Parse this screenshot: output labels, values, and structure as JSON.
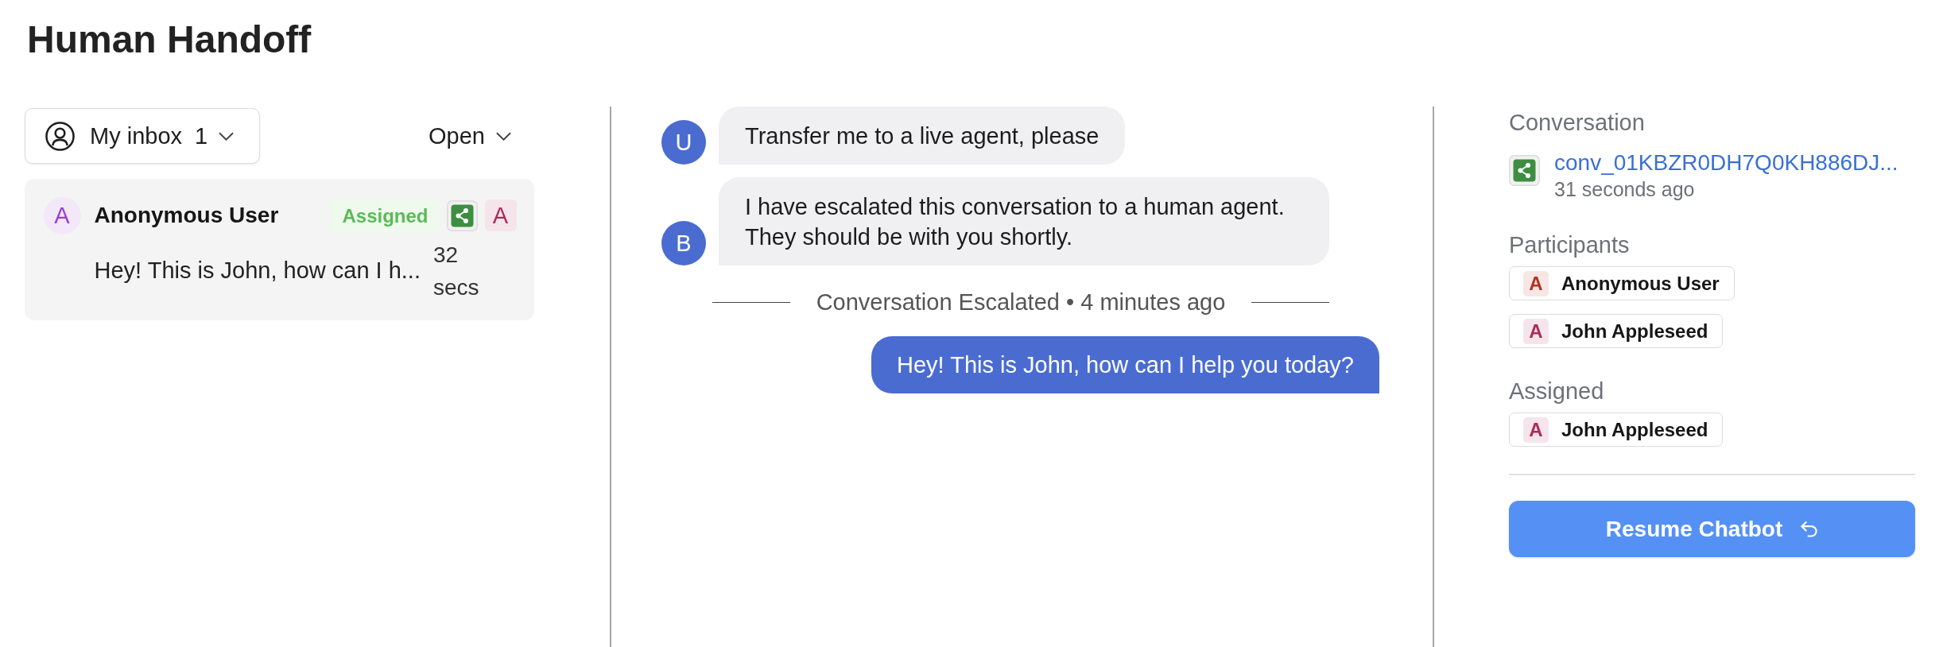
{
  "page": {
    "title": "Human Handoff"
  },
  "inbox": {
    "mailbox_filter": {
      "label": "My inbox",
      "count": "1"
    },
    "status_filter": {
      "label": "Open"
    },
    "conversations": [
      {
        "selected": true,
        "avatar": {
          "initial": "A",
          "color": "#9b3fcf"
        },
        "name": "Anonymous User",
        "status": "Assigned",
        "assignee": {
          "initial": "A",
          "color": "#ad2a5c"
        },
        "preview": "Hey! This is John, how can I h...",
        "time": "32 secs"
      }
    ]
  },
  "chat": {
    "messages": [
      {
        "kind": "incoming",
        "avatar": "U",
        "text": "Transfer me to a live agent, please"
      },
      {
        "kind": "incoming",
        "avatar": "B",
        "text": "I have escalated this conversation to a human agent. They should be with you shortly."
      },
      {
        "kind": "event",
        "text": "Conversation Escalated • 4 minutes ago"
      },
      {
        "kind": "outgoing",
        "text": "Hey! This is John, how can I help you today?"
      }
    ]
  },
  "details": {
    "conversation": {
      "heading": "Conversation",
      "id": "conv_01KBZR0DH7Q0KH886DJ...",
      "time": "31 seconds ago"
    },
    "participants": {
      "heading": "Participants",
      "people": [
        {
          "initial": "A",
          "name": "Anonymous User",
          "color": "#b2331f"
        },
        {
          "initial": "A",
          "name": "John Appleseed",
          "color": "#ad2a5c"
        }
      ]
    },
    "assigned": {
      "heading": "Assigned",
      "people": [
        {
          "initial": "A",
          "name": "John Appleseed",
          "color": "#ad2a5c"
        }
      ]
    },
    "action": {
      "label": "Resume Chatbot"
    }
  }
}
